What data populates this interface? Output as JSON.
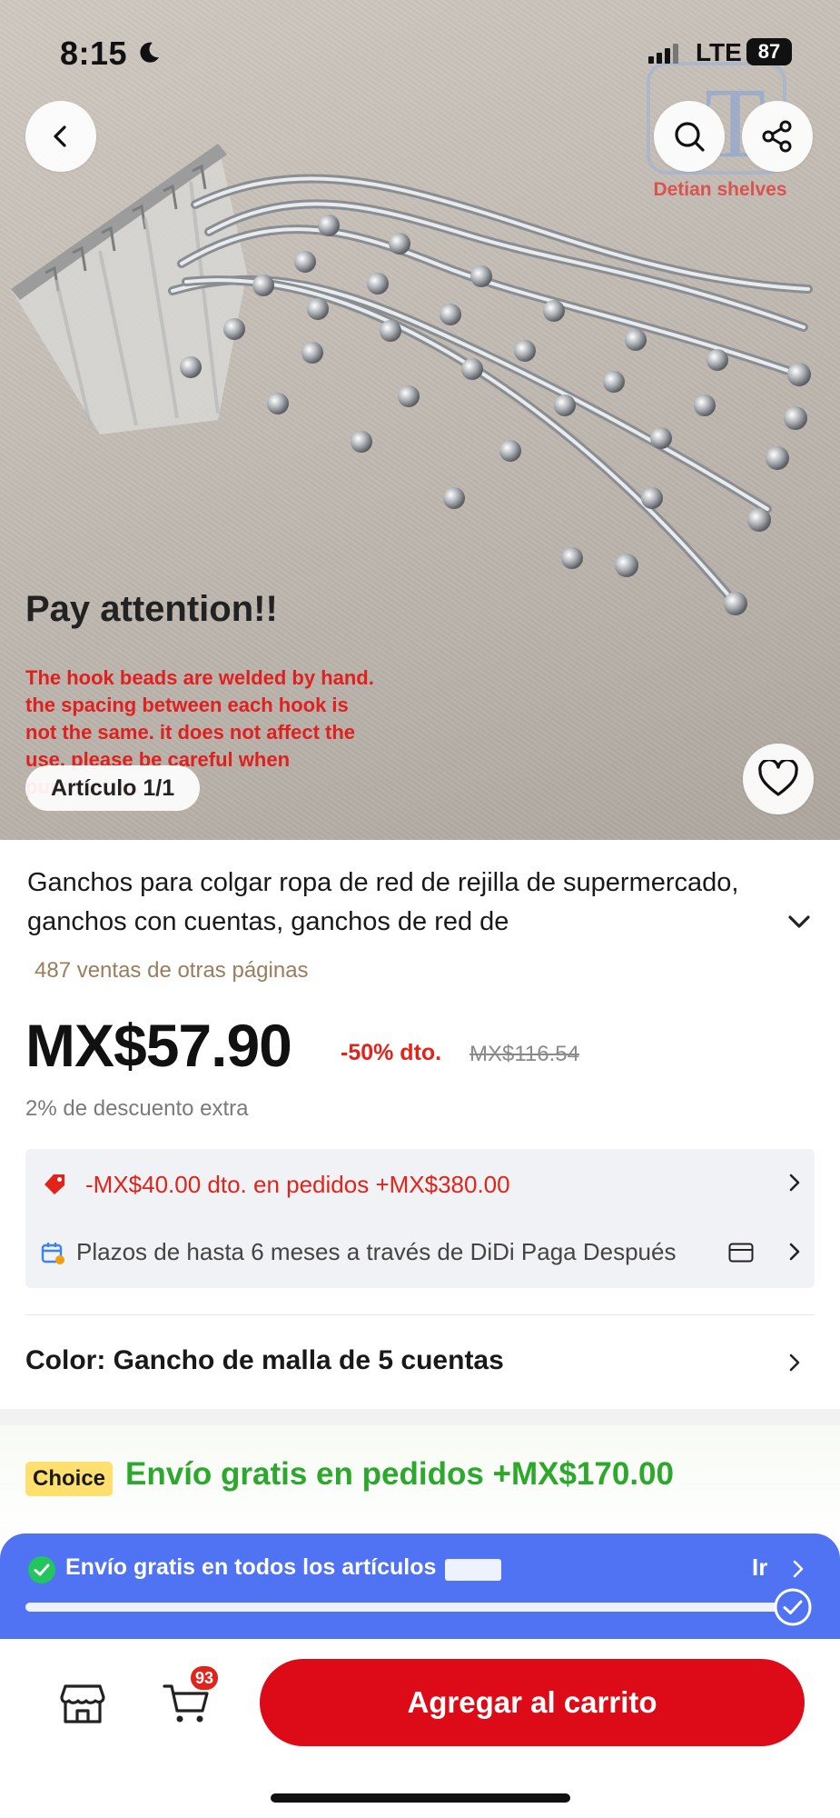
{
  "status_bar": {
    "time": "8:15",
    "network": "LTE",
    "battery": "87"
  },
  "hero": {
    "watermark_brand": "Detian shelves",
    "notice_title": "Pay attention!!",
    "notice_body": "The hook beads are welded by hand. the spacing between each hook is not the same. it does not affect the use. please be careful when purchasing.",
    "counter": "Artículo 1/1"
  },
  "product": {
    "title": "Ganchos para colgar ropa de red de rejilla de supermercado, ganchos con cuentas, ganchos de red de",
    "sales": "487 ventas de otras páginas",
    "price": "MX$57.90",
    "discount": "-50% dto.",
    "old_price": "MX$116.54",
    "extra_discount": "2% de descuento extra"
  },
  "promos": {
    "coupon": "-MX$40.00 dto. en pedidos +MX$380.00",
    "installments": "Plazos de hasta 6 meses a través de DiDi Paga Después"
  },
  "variant": {
    "label": "Color: Gancho de malla de 5 cuentas"
  },
  "choice": {
    "badge": "Choice",
    "text": "Envío gratis en pedidos +MX$170.00"
  },
  "shipping_bar": {
    "text": "Envío gratis en todos los artículos",
    "action": "Ir",
    "progress": 1.0
  },
  "bottom": {
    "cart_count": "93",
    "add_to_cart": "Agregar al carrito"
  },
  "colors": {
    "accent_red": "#dc0b17",
    "choice_green": "#2ca82c",
    "ship_blue": "#4f73f3",
    "badge_yellow": "#ffe06e"
  },
  "icons": [
    "back-icon",
    "search-icon",
    "share-icon",
    "heart-icon",
    "chevron-down-icon",
    "coupon-tag-icon",
    "calendar-icon",
    "card-icon",
    "chevron-right-icon",
    "check-circle-icon",
    "store-icon",
    "cart-icon"
  ]
}
